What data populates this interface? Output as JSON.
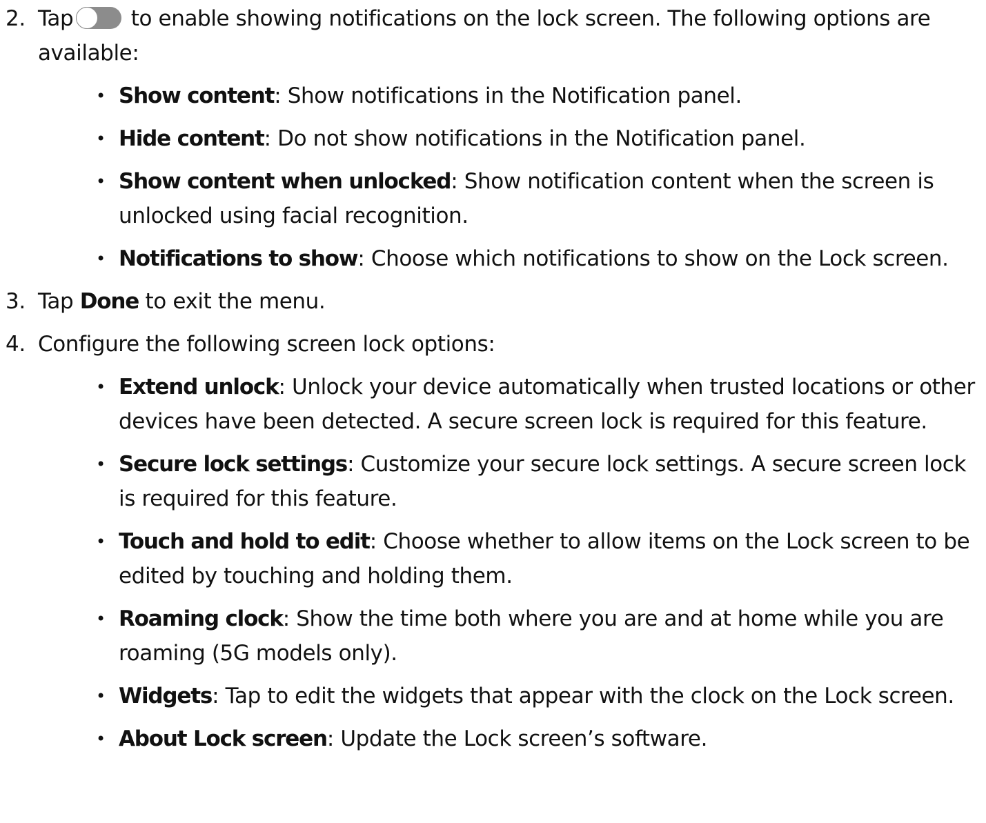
{
  "steps": [
    {
      "number": "2.",
      "text_before_icon": "Tap",
      "icon": "toggle-switch-off-icon",
      "text_after_icon": "to enable showing notifications on the lock screen. The following options are available:",
      "bullets": [
        {
          "term": "Show content",
          "description": ": Show notifications in the Notification panel."
        },
        {
          "term": "Hide content",
          "description": ": Do not show notifications in the Notification panel."
        },
        {
          "term": "Show content when unlocked",
          "description": ": Show notification content when the screen is unlocked using facial recognition."
        },
        {
          "term": "Notifications to show",
          "description": ": Choose which notifications to show on the Lock screen."
        }
      ]
    },
    {
      "number": "3.",
      "text_before": "Tap",
      "bold": "Done",
      "text_after": "to exit the menu."
    },
    {
      "number": "4.",
      "text": "Configure the following screen lock options:",
      "bullets": [
        {
          "term": "Extend unlock",
          "description": ": Unlock your device automatically when trusted locations or other devices have been detected. A secure screen lock is required for this feature."
        },
        {
          "term": "Secure lock settings",
          "description": ": Customize your secure lock settings. A secure screen lock is required for this feature."
        },
        {
          "term": "Touch and hold to edit",
          "description": ": Choose whether to allow items on the Lock screen to be edited by touching and holding them."
        },
        {
          "term": "Roaming clock",
          "description": ": Show the time both where you are and at home while you are roaming (5G models only)."
        },
        {
          "term": "Widgets",
          "description": ": Tap to edit the widgets that appear with the clock on the Lock screen."
        },
        {
          "term": "About Lock screen",
          "description": ": Update the Lock screen’s software."
        }
      ]
    }
  ],
  "bullet_glyph": "•",
  "colors": {
    "text": "#111111",
    "toggle_track": "#8c8c8c",
    "toggle_knob": "#ffffff"
  }
}
